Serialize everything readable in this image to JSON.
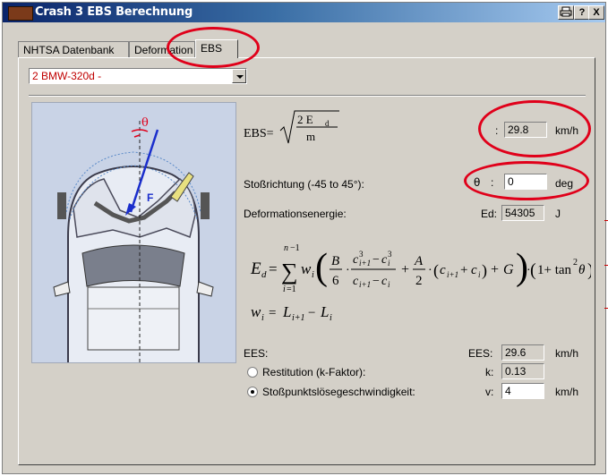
{
  "window": {
    "title": "Crash 3 EBS Berechnung",
    "btn_help": "?",
    "btn_close": "X"
  },
  "tabs": [
    {
      "label": "NHTSA Datenbank",
      "active": false
    },
    {
      "label": "Deformation",
      "active": false
    },
    {
      "label": "EBS",
      "active": true
    }
  ],
  "vehicle_select": {
    "value": "2 BMW-320d -"
  },
  "ebs": {
    "formula_lhs": "EBS=",
    "formula_num": "2  E",
    "formula_num_sub": "d",
    "formula_den": "m",
    "separator": ":",
    "value": "29.8",
    "unit": "km/h"
  },
  "direction": {
    "label": "Stoßrichtung (-45 to 45°):",
    "symbol": "θ",
    "separator": ":",
    "value": "0",
    "unit": "deg"
  },
  "deformation_energy": {
    "label": "Deformationsenergie:",
    "short": "Ed:",
    "value": "54305",
    "unit": "J"
  },
  "ees": {
    "label": "EES:",
    "short": "EES:",
    "value": "29.6",
    "unit": "km/h"
  },
  "restitution": {
    "label": "Restitution (k-Faktor):",
    "short": "k:",
    "value": "0.13",
    "selected": false
  },
  "separation": {
    "label": "Stoßpunktslösegeschwindigkeit:",
    "short": "v:",
    "value": "4",
    "unit": "km/h",
    "selected": true
  },
  "diagram": {
    "theta_label": "θ",
    "force_label": "F"
  },
  "colors": {
    "highlight_ring": "#e0001a",
    "force_arrow": "#1a2ecc",
    "select_text": "#c00000"
  }
}
